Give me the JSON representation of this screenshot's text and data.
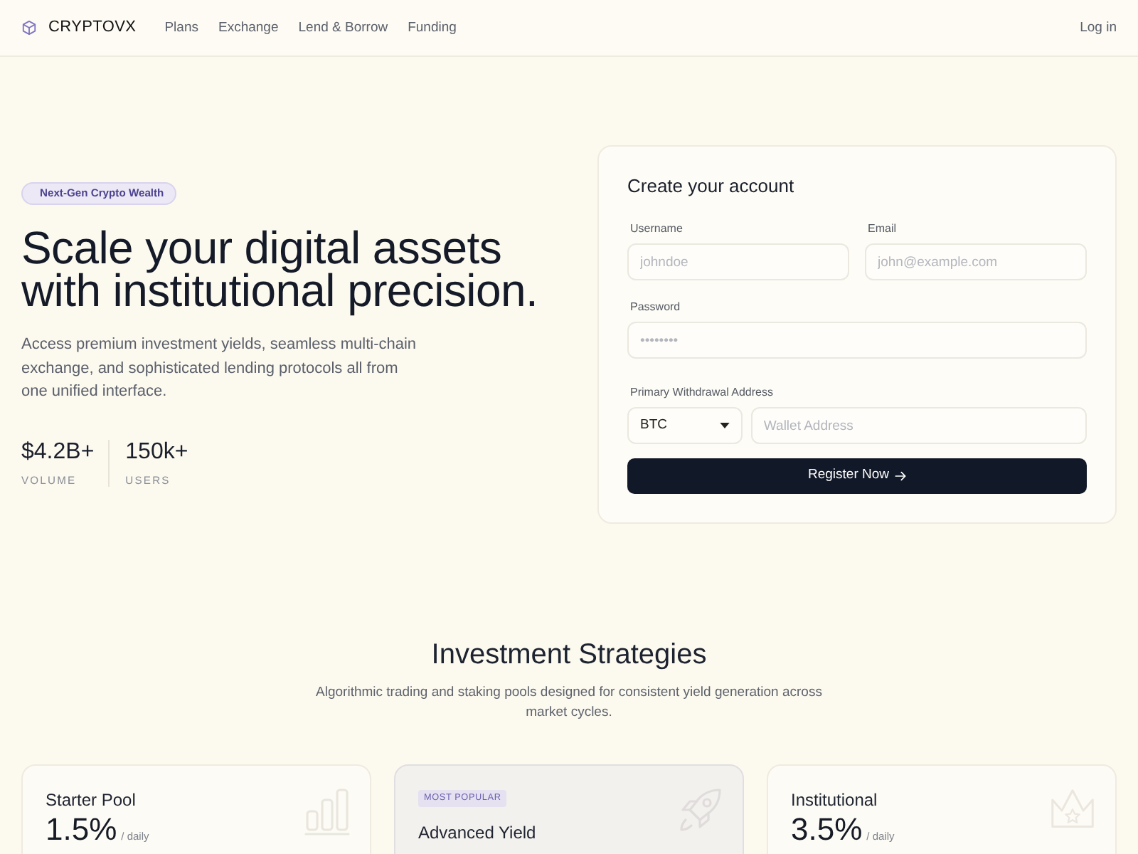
{
  "nav": {
    "brand": "CRYPTOVX",
    "links": [
      {
        "label": "Plans"
      },
      {
        "label": "Exchange"
      },
      {
        "label": "Lend & Borrow"
      },
      {
        "label": "Funding"
      }
    ],
    "login": "Log in"
  },
  "hero": {
    "badge": "Next-Gen Crypto Wealth",
    "title_lines": [
      "Scale your digital assets",
      "with institutional precision."
    ],
    "description": "Access premium investment yields, seamless multi-chain exchange, and sophisticated lending protocols all from one unified interface.",
    "stats": [
      {
        "value": "$4.2B+",
        "label": "VOLUME"
      },
      {
        "value": "150k+",
        "label": "USERS"
      }
    ]
  },
  "signup": {
    "title": "Create your account",
    "fields": [
      {
        "label": "Username",
        "placeholder": "johndoe"
      },
      {
        "label": "Email",
        "placeholder": "john@example.com"
      },
      {
        "label": "Password",
        "placeholder": "••••••••"
      }
    ],
    "withdrawal": {
      "label": "Primary Withdrawal Address",
      "currency": "BTC",
      "placeholder": "Wallet Address"
    },
    "submit": "Register Now"
  },
  "strategies": {
    "title": "Investment Strategies",
    "subtitle": "Algorithmic trading and staking pools designed for consistent yield generation across market cycles.",
    "plans": [
      {
        "name": "Starter Pool",
        "rate": "1.5%",
        "period": "/ daily",
        "featured": false
      },
      {
        "name": "Advanced Yield",
        "badge": "MOST POPULAR",
        "featured": true
      },
      {
        "name": "Institutional",
        "rate": "3.5%",
        "period": "/ daily",
        "featured": false
      }
    ]
  }
}
